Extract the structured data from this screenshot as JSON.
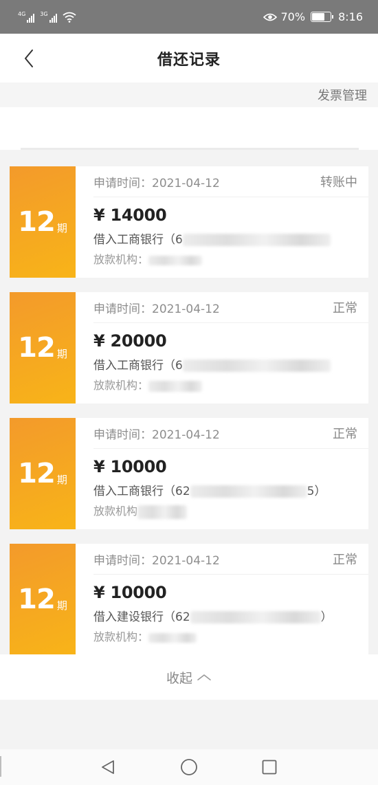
{
  "status_bar": {
    "network_1": "4G",
    "network_2": "3G",
    "battery_percent": "70%",
    "battery_level": 0.7,
    "time": "8:16"
  },
  "header": {
    "title": "借还记录"
  },
  "invoice": {
    "label": "发票管理"
  },
  "records": [
    {
      "term_num": "12",
      "term_unit": "期",
      "apply_time": "申请时间：2021-04-12",
      "status": "转账中",
      "amount": "¥ 14000",
      "bank_prefix": "借入工商银行（6",
      "bank_suffix": "",
      "lender_label": "放款机构："
    },
    {
      "term_num": "12",
      "term_unit": "期",
      "apply_time": "申请时间：2021-04-12",
      "status": "正常",
      "amount": "¥ 20000",
      "bank_prefix": "借入工商银行（6",
      "bank_suffix": "",
      "lender_label": "放款机构："
    },
    {
      "term_num": "12",
      "term_unit": "期",
      "apply_time": "申请时间：2021-04-12",
      "status": "正常",
      "amount": "¥ 10000",
      "bank_prefix": "借入工商银行（62",
      "bank_suffix": "5）",
      "lender_label": "放款机构"
    },
    {
      "term_num": "12",
      "term_unit": "期",
      "apply_time": "申请时间：2021-04-12",
      "status": "正常",
      "amount": "¥ 10000",
      "bank_prefix": "借入建设银行（62",
      "bank_suffix": "）",
      "lender_label": "放款机构："
    }
  ],
  "collapse": {
    "label": "收起"
  },
  "icons": {
    "back": "chevron-left-icon",
    "collapse": "chevron-up-icon",
    "nav_back": "triangle-back-icon",
    "nav_home": "circle-home-icon",
    "nav_recent": "square-recent-icon"
  }
}
